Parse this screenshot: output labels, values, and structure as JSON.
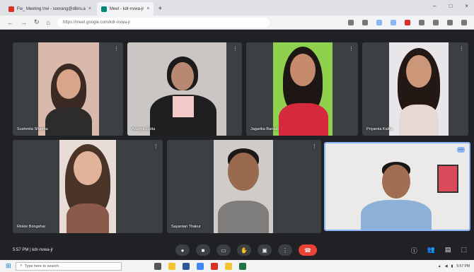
{
  "browser": {
    "tabs": [
      {
        "label": "Fw_ Meeting Invi - soorang@dibru.a",
        "active": false
      },
      {
        "label": "Meet - kdr-nvwa-jr",
        "active": true
      }
    ],
    "url": "https://meet.google.com/kdr-nvwa-jr"
  },
  "participants": [
    {
      "name": "Sushmita Sharma"
    },
    {
      "name": "Ananya Dutta"
    },
    {
      "name": "Jagarika Baruah"
    },
    {
      "name": "Priyanka Kalita"
    },
    {
      "name": "Rinkie Bongshai"
    },
    {
      "name": "Sayantan Thakur"
    },
    {
      "name": ""
    }
  ],
  "meeting": {
    "time": "5:57 PM",
    "separator": "|",
    "code": "kdr-nvwa-jr"
  },
  "controls": {
    "mic_icon": "mic-icon",
    "camera_icon": "camera-icon",
    "captions_icon": "captions-icon",
    "raise_hand_icon": "hand-icon",
    "present_icon": "present-icon",
    "more_icon": "more-vert-icon",
    "hangup_icon": "call-end-icon"
  },
  "taskbar": {
    "search_placeholder": "Type here to search",
    "clock": "5:57 PM"
  },
  "colors": {
    "meet_bg": "#202124",
    "tile_bg": "#3c4043",
    "hangup": "#ea4335",
    "active_border": "#8ab4f8"
  }
}
